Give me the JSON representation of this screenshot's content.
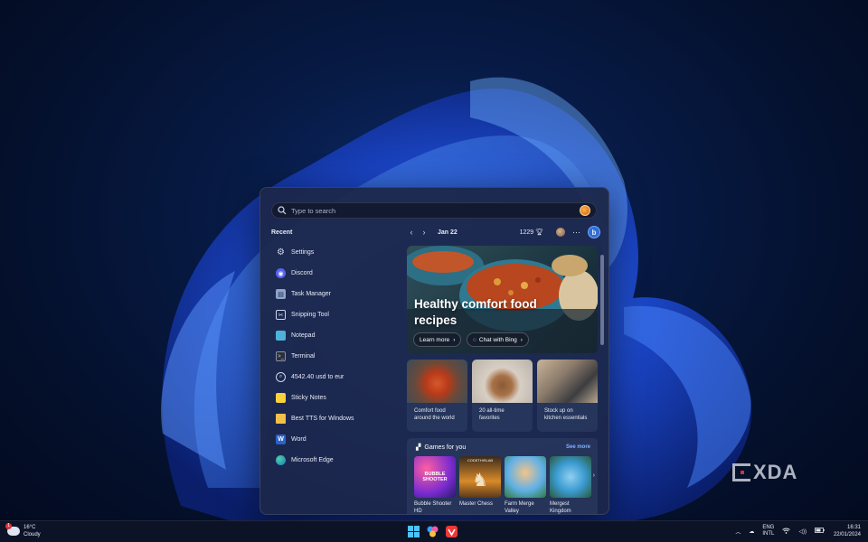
{
  "search": {
    "placeholder": "Type to search"
  },
  "recent": {
    "title": "Recent",
    "items": [
      {
        "label": "Settings",
        "icon": "gear-icon"
      },
      {
        "label": "Discord",
        "icon": "discord-icon"
      },
      {
        "label": "Task Manager",
        "icon": "task-manager-icon"
      },
      {
        "label": "Snipping Tool",
        "icon": "snipping-tool-icon"
      },
      {
        "label": "Notepad",
        "icon": "notepad-icon"
      },
      {
        "label": "Terminal",
        "icon": "terminal-icon"
      },
      {
        "label": "4542.40 usd to eur",
        "icon": "search-result-icon"
      },
      {
        "label": "Sticky Notes",
        "icon": "sticky-notes-icon"
      },
      {
        "label": "Best TTS for Windows",
        "icon": "folder-icon"
      },
      {
        "label": "Word",
        "icon": "word-icon"
      },
      {
        "label": "Microsoft Edge",
        "icon": "edge-icon"
      }
    ]
  },
  "highlights": {
    "date": "Jan 22",
    "points": "1229",
    "hero": {
      "title": "Healthy comfort food recipes",
      "learn_more": "Learn more",
      "chat_with_bing": "Chat with Bing"
    },
    "cards": [
      {
        "caption": "Comfort food around the world"
      },
      {
        "caption": "20 all-time favorites"
      },
      {
        "caption": "Stock up on kitchen essentials"
      }
    ],
    "games": {
      "title": "Games for you",
      "see_more": "See more",
      "items": [
        {
          "name": "Bubble Shooter HD",
          "tile_text": "BUBBLE SHOOTER"
        },
        {
          "name": "Master Chess",
          "tile_text": "CODETHISLAB"
        },
        {
          "name": "Farm Merge Valley",
          "tile_text": ""
        },
        {
          "name": "Mergest Kingdom",
          "tile_text": ""
        }
      ]
    }
  },
  "taskbar": {
    "weather_temp": "16°C",
    "weather_desc": "Cloudy",
    "weather_badge": "1",
    "lang_top": "ENG",
    "lang_bottom": "INTL",
    "time": "16:31",
    "date": "22/01/2024"
  },
  "watermark": "XDA",
  "colors": {
    "accent": "#2f6fd8",
    "see_more": "#7fb2ff",
    "panel_bg": "#1c2648"
  }
}
